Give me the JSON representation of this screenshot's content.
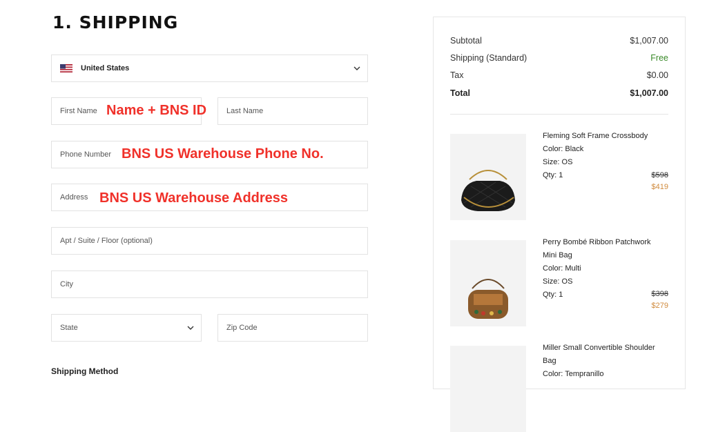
{
  "page": {
    "title": "1. SHIPPING"
  },
  "form": {
    "country": "United States",
    "first_name_placeholder": "First Name",
    "last_name_placeholder": "Last Name",
    "phone_placeholder": "Phone Number",
    "address_placeholder": "Address",
    "apt_placeholder": "Apt / Suite / Floor (optional)",
    "city_placeholder": "City",
    "state_placeholder": "State",
    "zip_placeholder": "Zip Code",
    "shipping_method_label": "Shipping Method"
  },
  "annotations": {
    "name": "Name + BNS ID",
    "phone": "BNS US Warehouse Phone No.",
    "address": "BNS US Warehouse Address",
    "color": "#f0312a"
  },
  "summary": {
    "subtotal_label": "Subtotal",
    "subtotal_value": "$1,007.00",
    "shipping_label": "Shipping (Standard)",
    "shipping_value": "Free",
    "tax_label": "Tax",
    "tax_value": "$0.00",
    "total_label": "Total",
    "total_value": "$1,007.00"
  },
  "items": [
    {
      "name": "Fleming Soft Frame Crossbody",
      "color": "Color: Black",
      "size": "Size: OS",
      "qty": "Qty: 1",
      "price_old": "$598",
      "price_new": "$419"
    },
    {
      "name_line1": "Perry Bombé Ribbon Patchwork",
      "name_line2": "Mini Bag",
      "color": "Color: Multi",
      "size": "Size: OS",
      "qty": "Qty: 1",
      "price_old": "$398",
      "price_new": "$279"
    },
    {
      "name_line1": "Miller Small Convertible Shoulder",
      "name_line2": "Bag",
      "color": "Color: Tempranillo"
    }
  ],
  "colors": {
    "sale_price": "#d08a3c",
    "free": "#3a8a2a"
  }
}
